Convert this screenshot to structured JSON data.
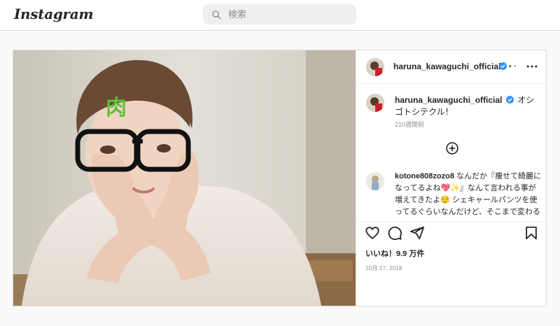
{
  "app": {
    "logo": "Instagram"
  },
  "search": {
    "placeholder": "検索"
  },
  "post": {
    "image_alt": "haruna_kawaguchi_official post photo",
    "header": {
      "username": "haruna_kawaguchi_official",
      "follow_dot": "• ･",
      "more_icon": "more-horizontal-icon"
    },
    "caption": {
      "username": "haruna_kawaguchi_official",
      "text": "オシゴトシテクル！",
      "time": "210週間前"
    },
    "overlay_text": "肉",
    "comment": {
      "username": "kotone808zozo8",
      "text": "なんだか『痩せて綺麗になってるよね💖✨』なんて言われる事が増えてきたよ😌 シェキャールパンツを使ってるぐらいなんだけど、そこまで変わる"
    },
    "actions": {
      "like_icon": "heart-icon",
      "comment_icon": "comment-icon",
      "share_icon": "share-icon",
      "save_icon": "bookmark-icon"
    },
    "likes": "いいね！9.9 万件",
    "date": "10月 27, 2018"
  },
  "colors": {
    "verified": "#3897f0",
    "overlay_text": "#5fbf3f",
    "text": "#262626",
    "muted": "#8e8e8e"
  }
}
